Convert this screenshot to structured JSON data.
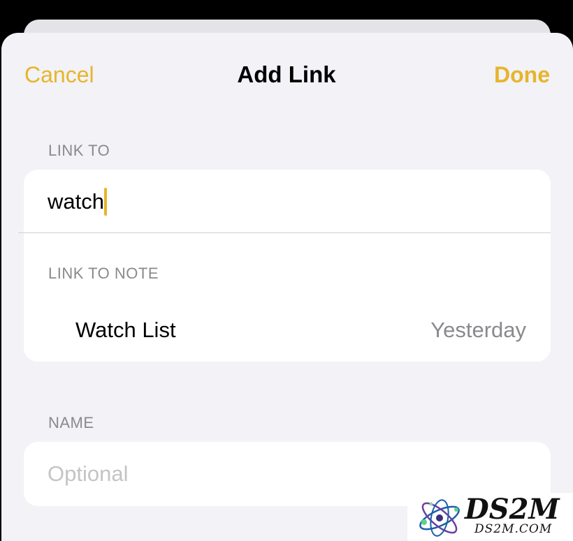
{
  "nav": {
    "cancel_label": "Cancel",
    "title": "Add Link",
    "done_label": "Done"
  },
  "link_to": {
    "header": "LINK TO",
    "value": "watch"
  },
  "link_to_note": {
    "header": "LINK TO NOTE",
    "items": [
      {
        "title": "Watch List",
        "date": "Yesterday"
      }
    ]
  },
  "name": {
    "header": "NAME",
    "placeholder": "Optional",
    "value": ""
  },
  "watermark": {
    "brand": "DS2M",
    "site": "DS2M.COM"
  },
  "colors": {
    "accent": "#e7b52b",
    "background": "#f2f2f7",
    "card": "#ffffff",
    "secondary_text": "#8a8a8e",
    "placeholder": "#c4c4c7"
  }
}
